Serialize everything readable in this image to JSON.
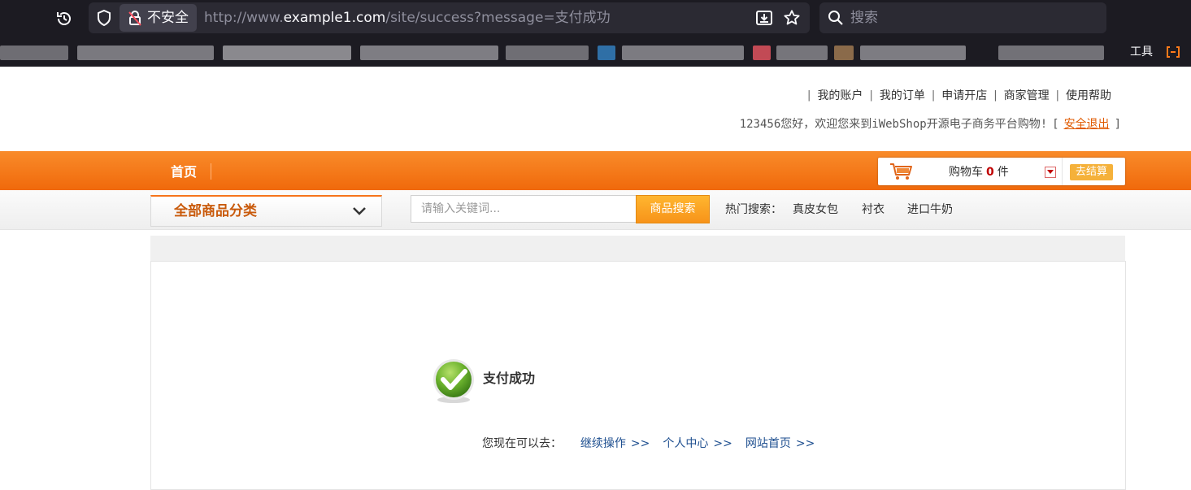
{
  "browser": {
    "insecure_label": "不安全",
    "url_prefix": "http://www.",
    "url_host": "example1.com",
    "url_path": "/site/success?message=支付成功",
    "search_placeholder": "搜索",
    "tools_label": "工具",
    "icons": [
      "history-icon",
      "shield-icon",
      "insecure-lock-icon",
      "download-icon",
      "star-icon",
      "search-icon",
      "tools-icon"
    ]
  },
  "header": {
    "top_links": [
      "我的账户",
      "我的订单",
      "申请开店",
      "商家管理",
      "使用帮助"
    ],
    "welcome_prefix": "123456您好，欢迎您来到iWebShop开源电子商务平台购物!",
    "bracket_open": "[",
    "logout": "安全退出",
    "bracket_close": "]"
  },
  "nav": {
    "home": "首页",
    "cart_label": "购物车",
    "cart_count": "0",
    "cart_unit": "件",
    "checkout": "去结算"
  },
  "search": {
    "category_label": "全部商品分类",
    "placeholder": "请输入关键词...",
    "button": "商品搜索",
    "hot_label": "热门搜索：",
    "hot_keywords": [
      "真皮女包",
      "衬衣",
      "进口牛奶"
    ]
  },
  "result": {
    "title": "支付成功",
    "next_label": "您现在可以去：",
    "links": [
      "继续操作",
      "个人中心",
      "网站首页"
    ],
    "arrow": ">>"
  },
  "colors": {
    "accent_orange": "#f6741b",
    "link_blue": "#1d4e8f",
    "logout_orange": "#e05a00",
    "success_green": "#5aa52a"
  }
}
